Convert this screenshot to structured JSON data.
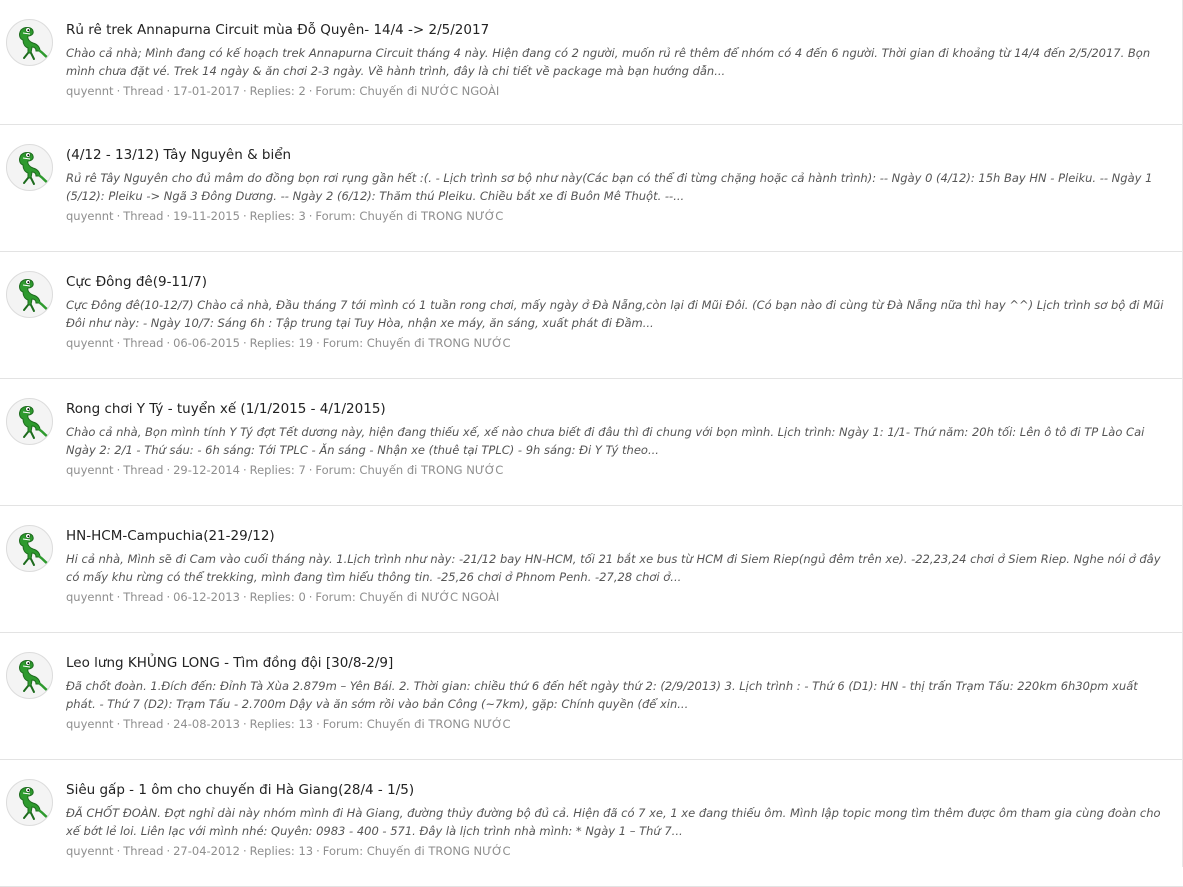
{
  "labels": {
    "thread": "Thread",
    "replies_prefix": "Replies:",
    "forum_prefix": "Forum:"
  },
  "avatar_icon": "crocodile-avatar-icon",
  "colors": {
    "title": "#222222",
    "snippet": "#555555",
    "meta": "#8e8e8e",
    "avatar_green": "#2e9a2e"
  },
  "threads": [
    {
      "title": "Rủ rê trek Annapurna Circuit mùa Đỗ Quyên- 14/4 -> 2/5/2017",
      "snippet": "Chào cả nhà; Mình đang có kế hoạch trek Annapurna Circuit tháng 4 này. Hiện đang có 2 người, muốn rủ rê thêm để nhóm có 4 đến 6 người. Thời gian đi khoảng từ 14/4 đến 2/5/2017. Bọn mình chưa đặt vé. Trek 14 ngày & ăn chơi 2-3 ngày. Về hành trình, đây là chi tiết về package mà bạn hướng dẫn...",
      "author": "quyennt",
      "date": "17-01-2017",
      "replies": "2",
      "forum": "Chuyến đi NƯỚC NGOÀI"
    },
    {
      "title": "(4/12 - 13/12) Tây Nguyên & biển",
      "snippet": "Rủ rê Tây Nguyên cho đủ mâm do đồng bọn rơi rụng gần hết :(. - Lịch trình sơ bộ như này(Các bạn có thể đi từng chặng hoặc cả hành trình): -- Ngày 0 (4/12): 15h Bay HN - Pleiku. -- Ngày 1 (5/12): Pleiku -> Ngã 3 Đông Dương. -- Ngày 2 (6/12): Thăm thú Pleiku. Chiều bắt xe đi Buôn Mê Thuột. --...",
      "author": "quyennt",
      "date": "19-11-2015",
      "replies": "3",
      "forum": "Chuyến đi TRONG NƯỚC"
    },
    {
      "title": "Cực Đông đê(9-11/7)",
      "snippet": "Cực Đông đê(10-12/7) Chào cả nhà, Đầu tháng 7 tới mình có 1 tuần rong chơi, mấy ngày ở Đà Nẵng,còn lại đi Mũi Đôi. (Có bạn nào đi cùng từ Đà Nẵng nữa thì hay ^^) Lịch trình sơ bộ đi Mũi Đôi như này: - Ngày 10/7: Sáng 6h : Tập trung tại Tuy Hòa, nhận xe máy, ăn sáng, xuất phát đi Đầm...",
      "author": "quyennt",
      "date": "06-06-2015",
      "replies": "19",
      "forum": "Chuyến đi TRONG NƯỚC"
    },
    {
      "title": "Rong chơi Y Tý - tuyển xế (1/1/2015 - 4/1/2015)",
      "snippet": "Chào cả nhà, Bọn mình tính Y Tý đợt Tết dương này, hiện đang thiếu xế, xế nào chưa biết đi đâu thì đi chung với bọn mình. Lịch trình: Ngày 1: 1/1- Thứ năm: 20h tối: Lên ô tô đi TP Lào Cai Ngày 2: 2/1 - Thứ sáu: - 6h sáng: Tới TPLC - Ăn sáng - Nhận xe (thuê tại TPLC) - 9h sáng: Đi Y Tý theo...",
      "author": "quyennt",
      "date": "29-12-2014",
      "replies": "7",
      "forum": "Chuyến đi TRONG NƯỚC"
    },
    {
      "title": "HN-HCM-Campuchia(21-29/12)",
      "snippet": "Hi cả nhà, Mình sẽ đi Cam vào cuối tháng này. 1.Lịch trình như này: -21/12 bay HN-HCM, tối 21 bắt xe bus từ HCM đi Siem Riep(ngủ đêm trên xe). -22,23,24 chơi ở Siem Riep. Nghe nói ở đây có mấy khu rừng có thể trekking, mình đang tìm hiểu thông tin. -25,26 chơi ở Phnom Penh. -27,28 chơi ở...",
      "author": "quyennt",
      "date": "06-12-2013",
      "replies": "0",
      "forum": "Chuyến đi NƯỚC NGOÀI"
    },
    {
      "title": "Leo lưng KHỦNG LONG - Tìm đồng đội [30/8-2/9]",
      "snippet": "Đã chốt đoàn. 1.Đích đến: Đỉnh Tà Xùa 2.879m – Yên Bái. 2. Thời gian: chiều thứ 6 đến hết ngày thứ 2: (2/9/2013) 3. Lịch trình : - Thứ 6 (D1): HN - thị trấn Trạm Tấu: 220km 6h30pm xuất phát. - Thứ 7 (D2): Trạm Tấu - 2.700m Dậy và ăn sớm rồi vào bản Công (~7km), gặp: Chính quyền (để xin...",
      "author": "quyennt",
      "date": "24-08-2013",
      "replies": "13",
      "forum": "Chuyến đi TRONG NƯỚC"
    },
    {
      "title": "Siêu gấp - 1 ôm cho chuyến đi Hà Giang(28/4 - 1/5)",
      "snippet": "ĐÃ CHỐT ĐOÀN. Đợt nghỉ dài này nhóm mình đi Hà Giang, đường thủy đường bộ đủ cả. Hiện đã có 7 xe, 1 xe đang thiếu ôm. Mình lập topic mong tìm thêm được ôm tham gia cùng đoàn cho xế bớt lẻ loi. Liên lạc với mình nhé: Quyên: 0983 - 400 - 571. Đây là lịch trình nhà mình: * Ngày 1 – Thứ 7...",
      "author": "quyennt",
      "date": "27-04-2012",
      "replies": "13",
      "forum": "Chuyến đi TRONG NƯỚC"
    }
  ]
}
